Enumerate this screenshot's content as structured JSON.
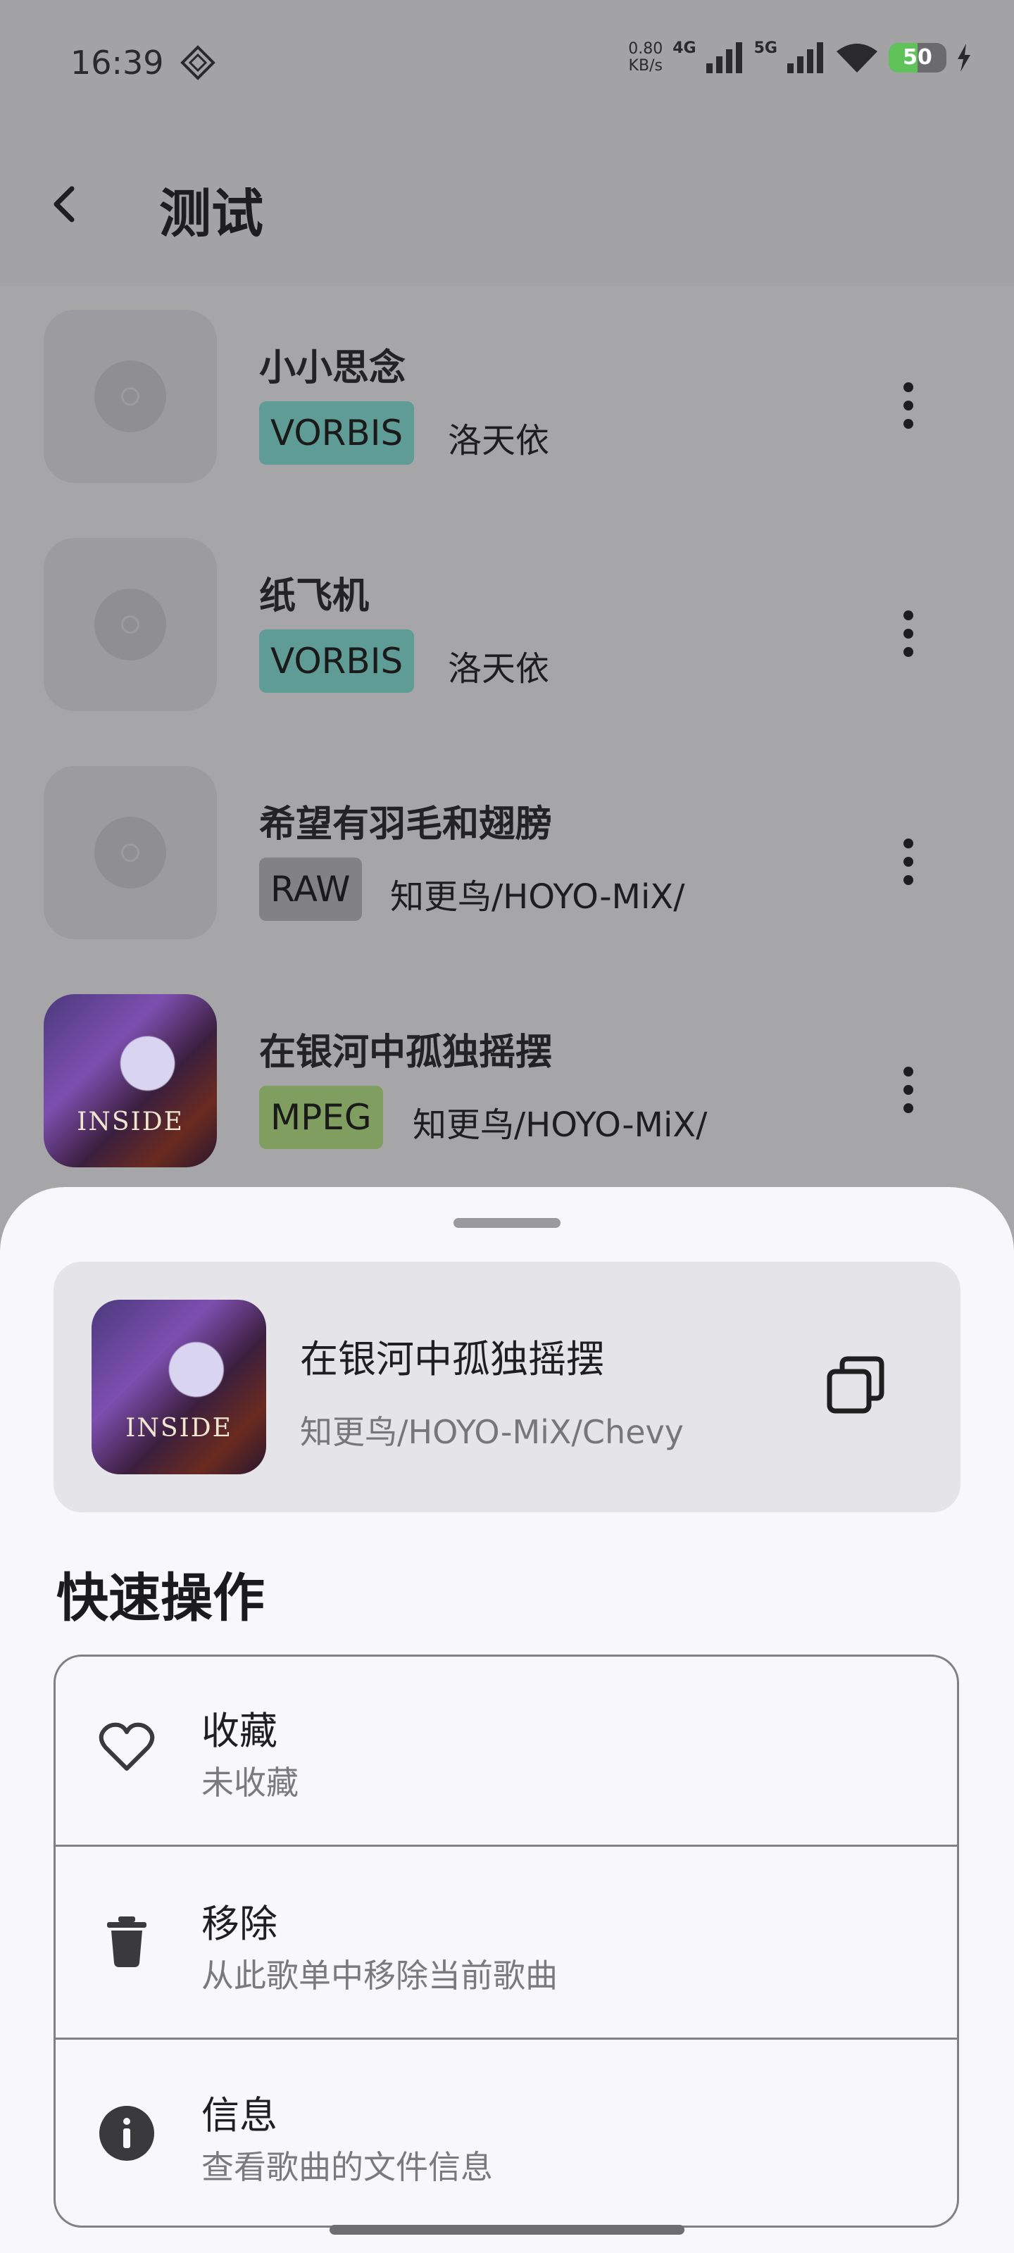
{
  "status_bar": {
    "time": "16:39",
    "net_speed_value": "0.80",
    "net_speed_unit": "KB/s",
    "signal_1": "4G",
    "signal_2": "5G",
    "battery": "50",
    "battery_level": 0.5
  },
  "header": {
    "title": "测试"
  },
  "songs": [
    {
      "title": "小小思念",
      "format": "VORBIS",
      "artist": "洛天依",
      "tag_color": "#5f9c95"
    },
    {
      "title": "纸飞机",
      "format": "VORBIS",
      "artist": "洛天依",
      "tag_color": "#5f9c95"
    },
    {
      "title": "希望有羽毛和翅膀",
      "format": "RAW",
      "artist": "知更鸟/HOYO-MiX/",
      "tag_color": "#828285"
    },
    {
      "title": "在银河中孤独摇摆",
      "format": "MPEG",
      "artist": "知更鸟/HOYO-MiX/",
      "tag_color": "#7f9e5f",
      "cover_text": "INSIDE"
    }
  ],
  "sheet": {
    "now_playing": {
      "title": "在银河中孤独摇摆",
      "artist": "知更鸟/HOYO-MiX/Chevy",
      "cover_text": "INSIDE"
    },
    "section_title": "快速操作",
    "actions": [
      {
        "title": "收藏",
        "subtitle": "未收藏",
        "icon": "heart-outline-icon"
      },
      {
        "title": "移除",
        "subtitle": "从此歌单中移除当前歌曲",
        "icon": "trash-icon"
      },
      {
        "title": "信息",
        "subtitle": "查看歌曲的文件信息",
        "icon": "info-icon"
      }
    ]
  }
}
